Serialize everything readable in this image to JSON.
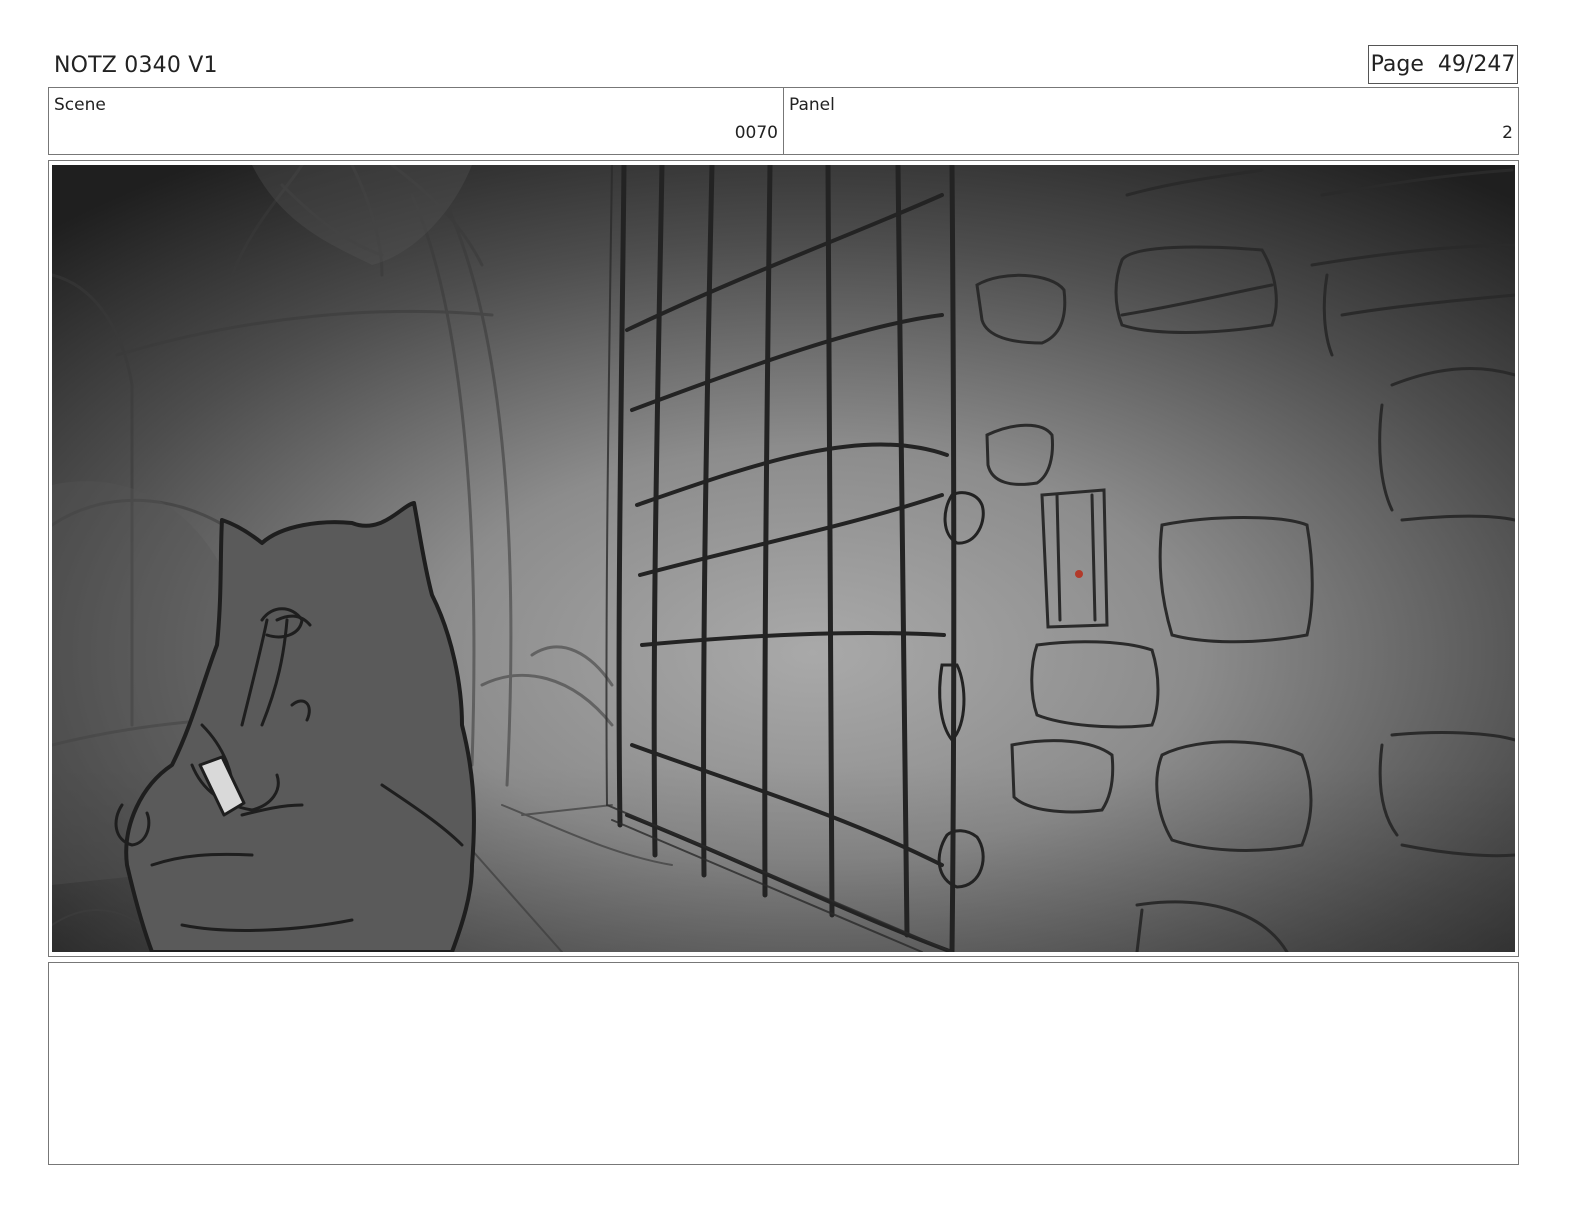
{
  "header": {
    "title": "NOTZ 0340 V1",
    "page_label": "Page",
    "page_number": "49/247"
  },
  "info": {
    "scene_label": "Scene",
    "scene_value": "0070",
    "panel_label": "Panel",
    "panel_value": "2"
  },
  "notes": {
    "text": ""
  }
}
